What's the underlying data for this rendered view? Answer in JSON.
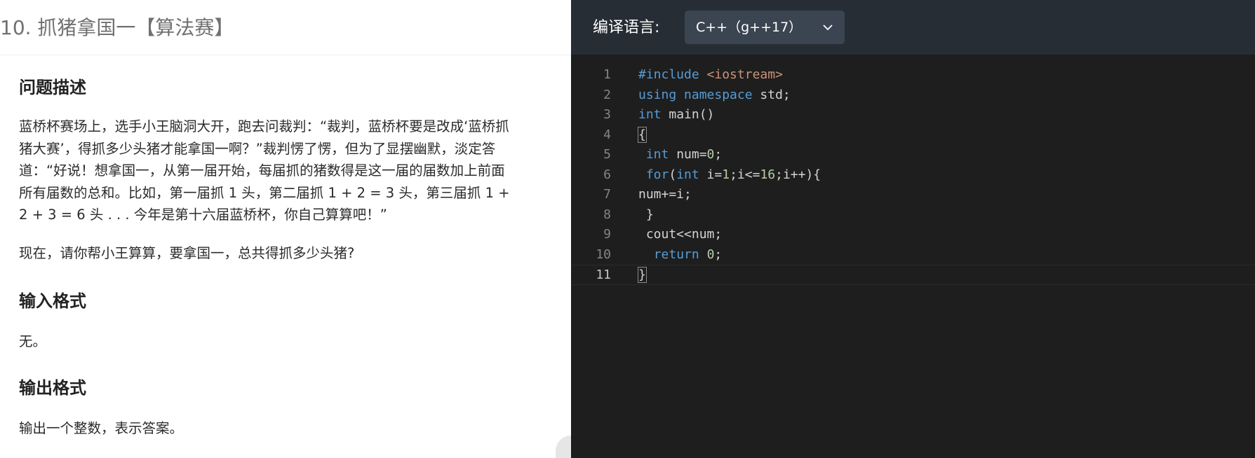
{
  "problem": {
    "title": "10. 抓猪拿国一【算法赛】",
    "sections": {
      "description_heading": "问题描述",
      "description_lines": [
        "蓝桥杯赛场上，选手小王脑洞大开，跑去问裁判：“裁判，蓝桥杯要是改成‘蓝桥抓",
        "猪大赛’，得抓多少头猪才能拿国一啊？”裁判愣了愣，但为了显摆幽默，淡定答",
        "道：“好说！想拿国一，从第一届开始，每届抓的猪数得是这一届的届数加上前面",
        "所有届数的总和。比如，第一届抓 1 头，第二届抓 1 + 2 = 3 头，第三届抓 1 +",
        "2 + 3 = 6 头 . . . 今年是第十六届蓝桥杯，你自己算算吧！”"
      ],
      "question": "现在，请你帮小王算算，要拿国一，总共得抓多少头猪?",
      "input_heading": "输入格式",
      "input_text": "无。",
      "output_heading": "输出格式",
      "output_text": "输出一个整数，表示答案。"
    }
  },
  "editor": {
    "language_label": "编译语言:",
    "language_selected": "C++（g++17）",
    "active_line": 11,
    "lines": [
      {
        "no": "1",
        "code": "#include <iostream>"
      },
      {
        "no": "2",
        "code": "using namespace std;"
      },
      {
        "no": "3",
        "code": "int main()"
      },
      {
        "no": "4",
        "code": "{"
      },
      {
        "no": "5",
        "code": " int num=0;"
      },
      {
        "no": "6",
        "code": " for(int i=1;i<=16;i++){"
      },
      {
        "no": "7",
        "code": "num+=i;"
      },
      {
        "no": "8",
        "code": " }"
      },
      {
        "no": "9",
        "code": " cout<<num;"
      },
      {
        "no": "10",
        "code": "  return 0;"
      },
      {
        "no": "11",
        "code": "}"
      }
    ],
    "colors": {
      "background": "#1e1e1e",
      "keyword": "#569cd6",
      "number": "#b5cea8",
      "include_path": "#ce9178",
      "text": "#d4d4d4",
      "line_number": "#858585"
    }
  }
}
